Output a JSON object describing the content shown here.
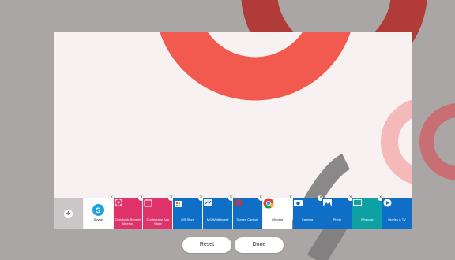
{
  "colors": {
    "background": "#aaa6a5",
    "preview_background": "#f7f1f1",
    "accent_red": "#f25a4f",
    "dark_red": "#b13b38"
  },
  "dock": {
    "add_icon": "plus-icon",
    "apps": [
      {
        "label": "Skype",
        "icon": "skype-icon",
        "color": "#ffffff"
      },
      {
        "label": "OneQuick Remote Meeting",
        "icon": "remote-meeting-icon",
        "color": "#e0336c"
      },
      {
        "label": "Conference App Store",
        "icon": "app-store-icon",
        "color": "#e0336c"
      },
      {
        "label": "MS Store",
        "icon": "ms-store-icon",
        "color": "#0f6fc6"
      },
      {
        "label": "MS Whiteboard",
        "icon": "whiteboard-icon",
        "color": "#0f6fc6"
      },
      {
        "label": "Screen Capture",
        "icon": "screen-capture-icon",
        "color": "#0f6fc6"
      },
      {
        "label": "Chrome",
        "icon": "chrome-icon",
        "color": "#ffffff"
      },
      {
        "label": "Camera",
        "icon": "camera-icon",
        "color": "#0f6fc6"
      },
      {
        "label": "Photo",
        "icon": "photo-icon",
        "color": "#0f6fc6"
      },
      {
        "label": "Wirecast",
        "icon": "wirecast-icon",
        "color": "#0ea1a4"
      },
      {
        "label": "Movies & TV",
        "icon": "movies-tv-icon",
        "color": "#0f6fc6"
      }
    ]
  },
  "buttons": {
    "reset": "Reset",
    "done": "Done"
  }
}
